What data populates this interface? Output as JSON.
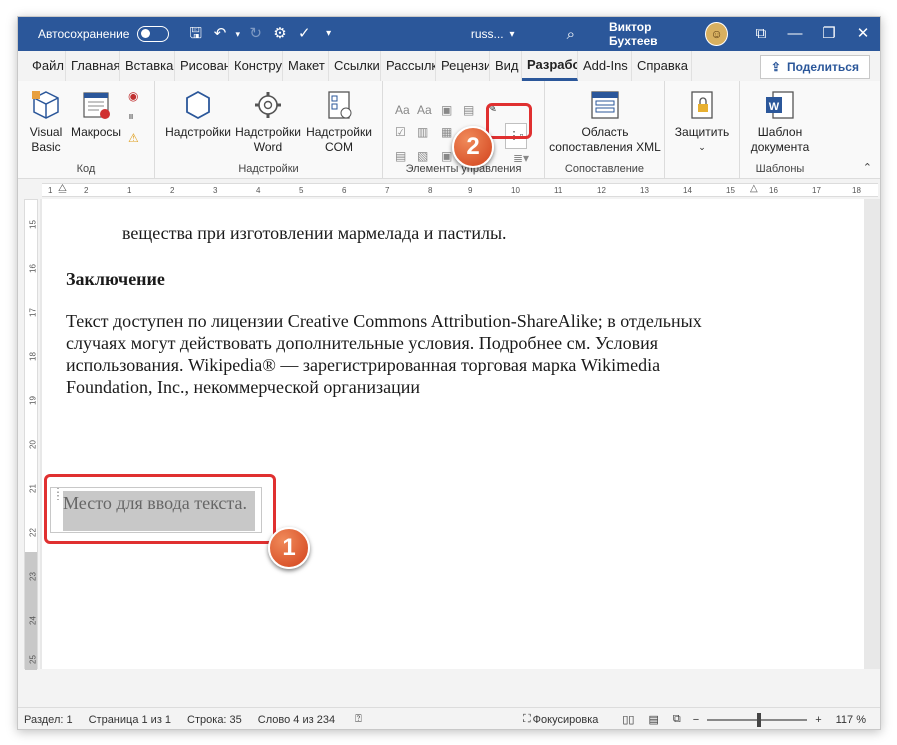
{
  "titlebar": {
    "autosave_label": "Автосохранение",
    "doc_title": "russ...",
    "user_name": "Виктор Бухтеев"
  },
  "tabs": [
    {
      "label": "Файл"
    },
    {
      "label": "Главная"
    },
    {
      "label": "Вставка"
    },
    {
      "label": "Рисован"
    },
    {
      "label": "Констру"
    },
    {
      "label": "Макет"
    },
    {
      "label": "Ссылки"
    },
    {
      "label": "Рассылк"
    },
    {
      "label": "Рецензи"
    },
    {
      "label": "Вид"
    },
    {
      "label": "Разрабо"
    },
    {
      "label": "Add-Ins"
    },
    {
      "label": "Справка"
    }
  ],
  "share_label": "Поделиться",
  "ribbon": {
    "code": {
      "label": "Код",
      "visual_basic": "Visual Basic",
      "macros": "Макросы"
    },
    "addins": {
      "label": "Надстройки",
      "addins_btn": "Надстройки",
      "word_addins": "Надстройки Word",
      "com_addins": "Надстройки COM"
    },
    "controls": {
      "label": "Элементы управления"
    },
    "mapping": {
      "label": "Сопоставление",
      "xml_pane": "Область сопоставления XML"
    },
    "protect": {
      "protect_btn": "Защитить"
    },
    "templates": {
      "label": "Шаблоны",
      "doc_template": "Шаблон документа"
    }
  },
  "ruler": {
    "h_ticks": [
      "1",
      "2",
      "1",
      "2",
      "3",
      "4",
      "5",
      "6",
      "7",
      "8",
      "9",
      "10",
      "11",
      "12",
      "13",
      "14",
      "15",
      "16",
      "17",
      "18"
    ],
    "v_ticks": [
      "15",
      "16",
      "17",
      "18",
      "19",
      "20",
      "21",
      "22",
      "23",
      "24",
      "25"
    ]
  },
  "document": {
    "line_top": "вещества при изготовлении мармелада и пастилы.",
    "heading": "Заключение",
    "para_line1": "Текст доступен по лицензии Creative Commons Attribution-ShareAlike; в отдельных",
    "para_line2": "случаях могут действовать дополнительные условия. Подробнее см. Условия",
    "para_line3": "использования. Wikipedia® — зарегистрированная торговая марка Wikimedia",
    "para_line4": "Foundation, Inc., некоммерческой организации",
    "content_control_placeholder": "Место для ввода текста."
  },
  "statusbar": {
    "section": "Раздел: 1",
    "page": "Страница 1 из 1",
    "line": "Строка: 35",
    "word": "Слово 4 из 234",
    "focus": "Фокусировка",
    "zoom": "117 %",
    "zoom_minus": "−",
    "zoom_plus": "+"
  },
  "annotations": {
    "badge1": "1",
    "badge2": "2"
  },
  "colors": {
    "titlebar": "#2b579a",
    "annotation_red": "#e03030",
    "badge_orange": "#d2421c"
  }
}
